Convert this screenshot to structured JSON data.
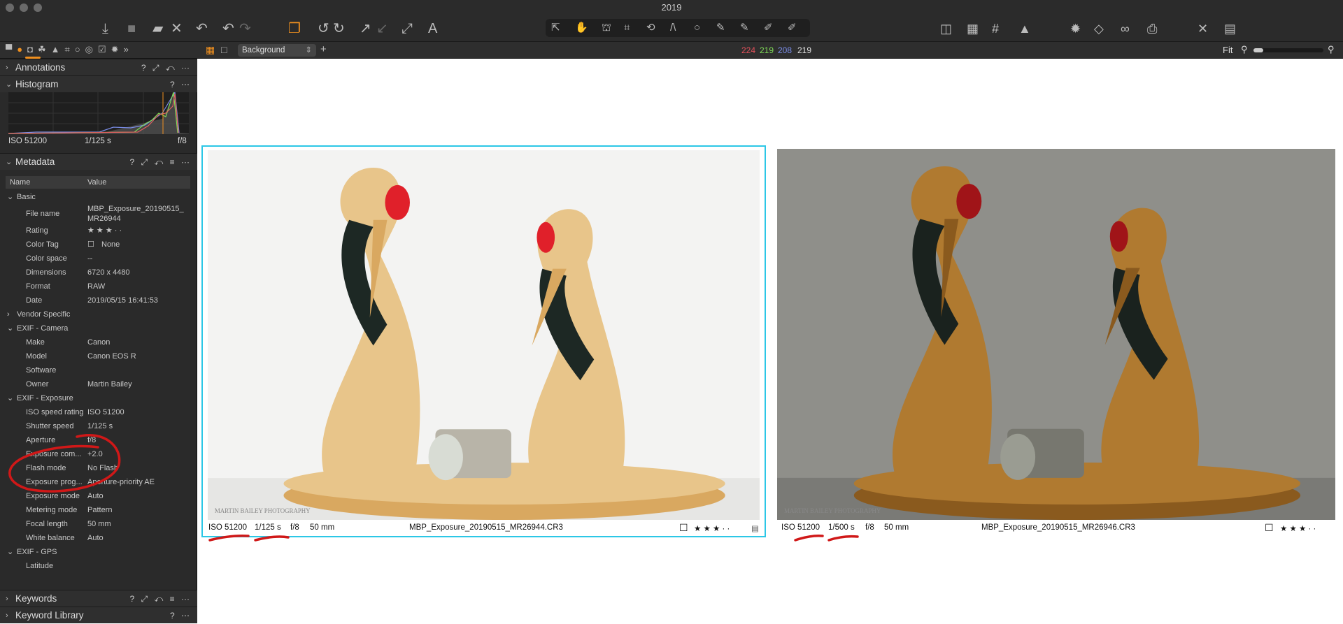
{
  "window": {
    "title": "2019"
  },
  "toolbar": {
    "left_icons": [
      "import-icon",
      "capture-icon",
      "export-icon",
      "delete-icon",
      "undo-adjustment-icon",
      "undo-icon",
      "redo-icon"
    ],
    "center_icons": [
      "variants-icon",
      "rotate-left-icon",
      "rotate-right-icon",
      "copy-adjustments-icon",
      "apply-adjustments-icon",
      "expand-icon",
      "text-icon"
    ],
    "cursor_tools": [
      "select-icon",
      "pan-icon",
      "loupe-icon",
      "crop-icon",
      "rotate-icon",
      "keystone-icon",
      "spot-icon",
      "brush-icon",
      "pen-icon",
      "eraser-icon",
      "annotate-icon"
    ],
    "right_icons": [
      "proof-icon",
      "exposure-warning-icon",
      "grid-icon",
      "warning-icon",
      "settings-icon",
      "compare-icon",
      "glasses-icon",
      "print-icon",
      "tools-icon",
      "layout-icon"
    ]
  },
  "bar2": {
    "layer": "Background",
    "rgb": {
      "r": "224",
      "g": "219",
      "b": "208",
      "l": "219"
    },
    "zoom_label": "Fit",
    "colors": {
      "r": "#e0505a",
      "g": "#7ed957",
      "b": "#7a8de8"
    },
    "zoom_level": 0.1
  },
  "left_panel": {
    "annotations": "Annotations",
    "histogram": {
      "title": "Histogram",
      "iso": "ISO 51200",
      "shutter": "1/125 s",
      "aperture": "f/8"
    },
    "metadata": {
      "title": "Metadata",
      "col_name": "Name",
      "col_value": "Value",
      "groups": [
        {
          "label": "Basic",
          "rows": [
            {
              "n": "File name",
              "v": "MBP_Exposure_20190515_",
              "v2": "MR26944"
            },
            {
              "n": "Rating",
              "v": "★ ★ ★ ·  ·"
            },
            {
              "n": "Color Tag",
              "v": "None"
            },
            {
              "n": "Color space",
              "v": "--"
            },
            {
              "n": "Dimensions",
              "v": "6720 x 4480"
            },
            {
              "n": "Format",
              "v": "RAW"
            },
            {
              "n": "Date",
              "v": "2019/05/15 16:41:53"
            }
          ]
        },
        {
          "label": "Vendor Specific"
        },
        {
          "label": "EXIF - Camera",
          "rows": [
            {
              "n": "Make",
              "v": "Canon"
            },
            {
              "n": "Model",
              "v": "Canon EOS R"
            },
            {
              "n": "Software",
              "v": ""
            },
            {
              "n": "Owner",
              "v": "Martin Bailey"
            }
          ]
        },
        {
          "label": "EXIF - Exposure",
          "rows": [
            {
              "n": "ISO speed rating",
              "v": "ISO 51200"
            },
            {
              "n": "Shutter speed",
              "v": "1/125 s"
            },
            {
              "n": "Aperture",
              "v": "f/8"
            },
            {
              "n": "Exposure com...",
              "v": "+2.0"
            },
            {
              "n": "Flash mode",
              "v": "No Flash"
            },
            {
              "n": "Exposure prog...",
              "v": "Aperture-priority AE"
            },
            {
              "n": "Exposure mode",
              "v": "Auto"
            },
            {
              "n": "Metering mode",
              "v": "Pattern"
            },
            {
              "n": "Focal length",
              "v": "50 mm"
            },
            {
              "n": "White balance",
              "v": "Auto"
            }
          ]
        },
        {
          "label": "EXIF - GPS",
          "rows": [
            {
              "n": "Latitude",
              "v": ""
            }
          ]
        }
      ]
    },
    "keywords": "Keywords",
    "keyword_library": "Keyword Library"
  },
  "viewer": {
    "images": [
      {
        "iso": "ISO 51200",
        "shutter": "1/125 s",
        "aperture": "f/8",
        "focal": "50 mm",
        "filename": "MBP_Exposure_20190515_MR26944.CR3",
        "rating": "★ ★ ★ ·  ·",
        "watermark": "Martin Bailey Photography",
        "selected": true
      },
      {
        "iso": "ISO 51200",
        "shutter": "1/500 s",
        "aperture": "f/8",
        "focal": "50 mm",
        "filename": "MBP_Exposure_20190515_MR26946.CR3",
        "rating": "★ ★ ★ ·  ·",
        "watermark": "Martin Bailey Photography",
        "selected": false
      }
    ],
    "selection_color": "#2cc7e6",
    "annotation_color": "#d01818"
  }
}
